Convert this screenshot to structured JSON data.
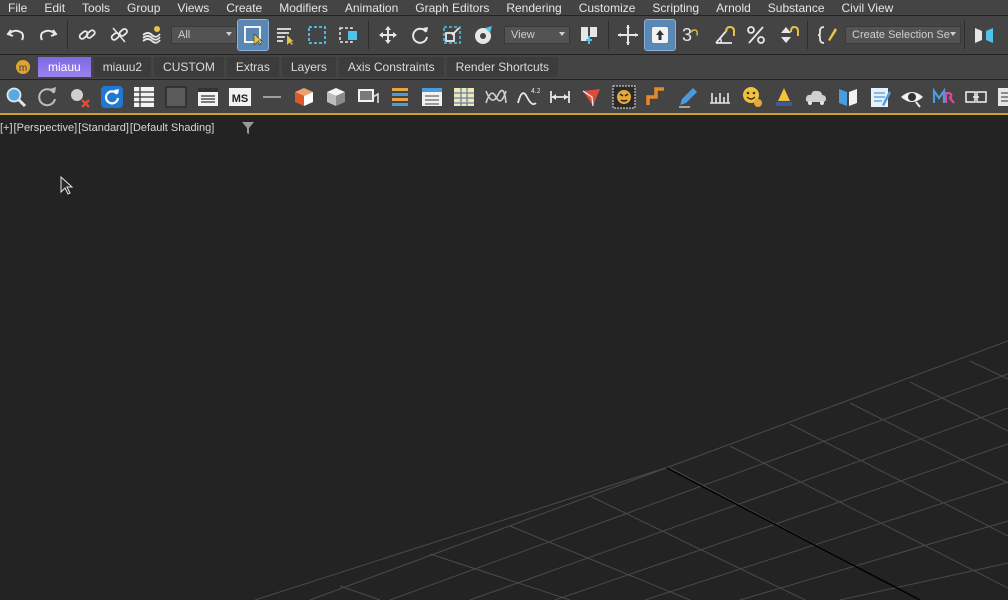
{
  "menu": [
    "File",
    "Edit",
    "Tools",
    "Group",
    "Views",
    "Create",
    "Modifiers",
    "Animation",
    "Graph Editors",
    "Rendering",
    "Customize",
    "Scripting",
    "Arnold",
    "Substance",
    "Civil View"
  ],
  "toolbar": {
    "selection_filter": "All",
    "ref_coord": "View",
    "snap_label": "3",
    "named_selection": "Create Selection Se"
  },
  "tabs": [
    "miauu",
    "miauu2",
    "CUSTOM",
    "Extras",
    "Layers",
    "Axis Constraints",
    "Render Shortcuts"
  ],
  "active_tab": "miauu",
  "viewport": {
    "label_plus": "[+]",
    "label_view": "[Perspective]",
    "label_shading_std": "[Standard]",
    "label_shading": "[Default Shading]"
  },
  "icons": {
    "toolbar": [
      "undo-icon",
      "redo-icon",
      "link-icon",
      "unlink-icon",
      "bind-spacewarp-icon",
      "select-object-icon",
      "select-by-name-icon",
      "rect-selection-icon",
      "window-crossing-icon",
      "move-icon",
      "rotate-icon",
      "scale-icon",
      "placement-icon",
      "use-pivot-icon",
      "manipulate-icon",
      "keyboard-shortcut-icon",
      "snap-icon",
      "angle-snap-icon",
      "percent-snap-icon",
      "spinner-snap-icon",
      "edit-named-selection-icon",
      "mirror-icon"
    ],
    "row": [
      "search-icon",
      "reset-icon",
      "delete-icon",
      "refresh-icon",
      "table-icon",
      "material-icon",
      "panel-icon",
      "maxscript-icon",
      "line-icon",
      "box-icon",
      "cube-icon",
      "render-icon",
      "layers-icon",
      "explorer-icon",
      "grid-table-icon",
      "curve-editor-icon",
      "wave-icon",
      "measure-icon",
      "pointer-icon",
      "tiger-icon",
      "hook-icon",
      "pencil-icon",
      "ruler-icon",
      "smiley-icon",
      "lamp-icon",
      "cloud-icon",
      "flag-icon",
      "notepad-icon",
      "eye-icon",
      "mr-icon",
      "connector-icon",
      "more-icon"
    ]
  },
  "colors": {
    "ui_bg": "#444444",
    "viewport_bg": "#232323",
    "accent_active": "#5b87b5",
    "tab_selected": "#9c82f0",
    "grid_line": "#4a4a4a",
    "axis_line": "#000000"
  }
}
